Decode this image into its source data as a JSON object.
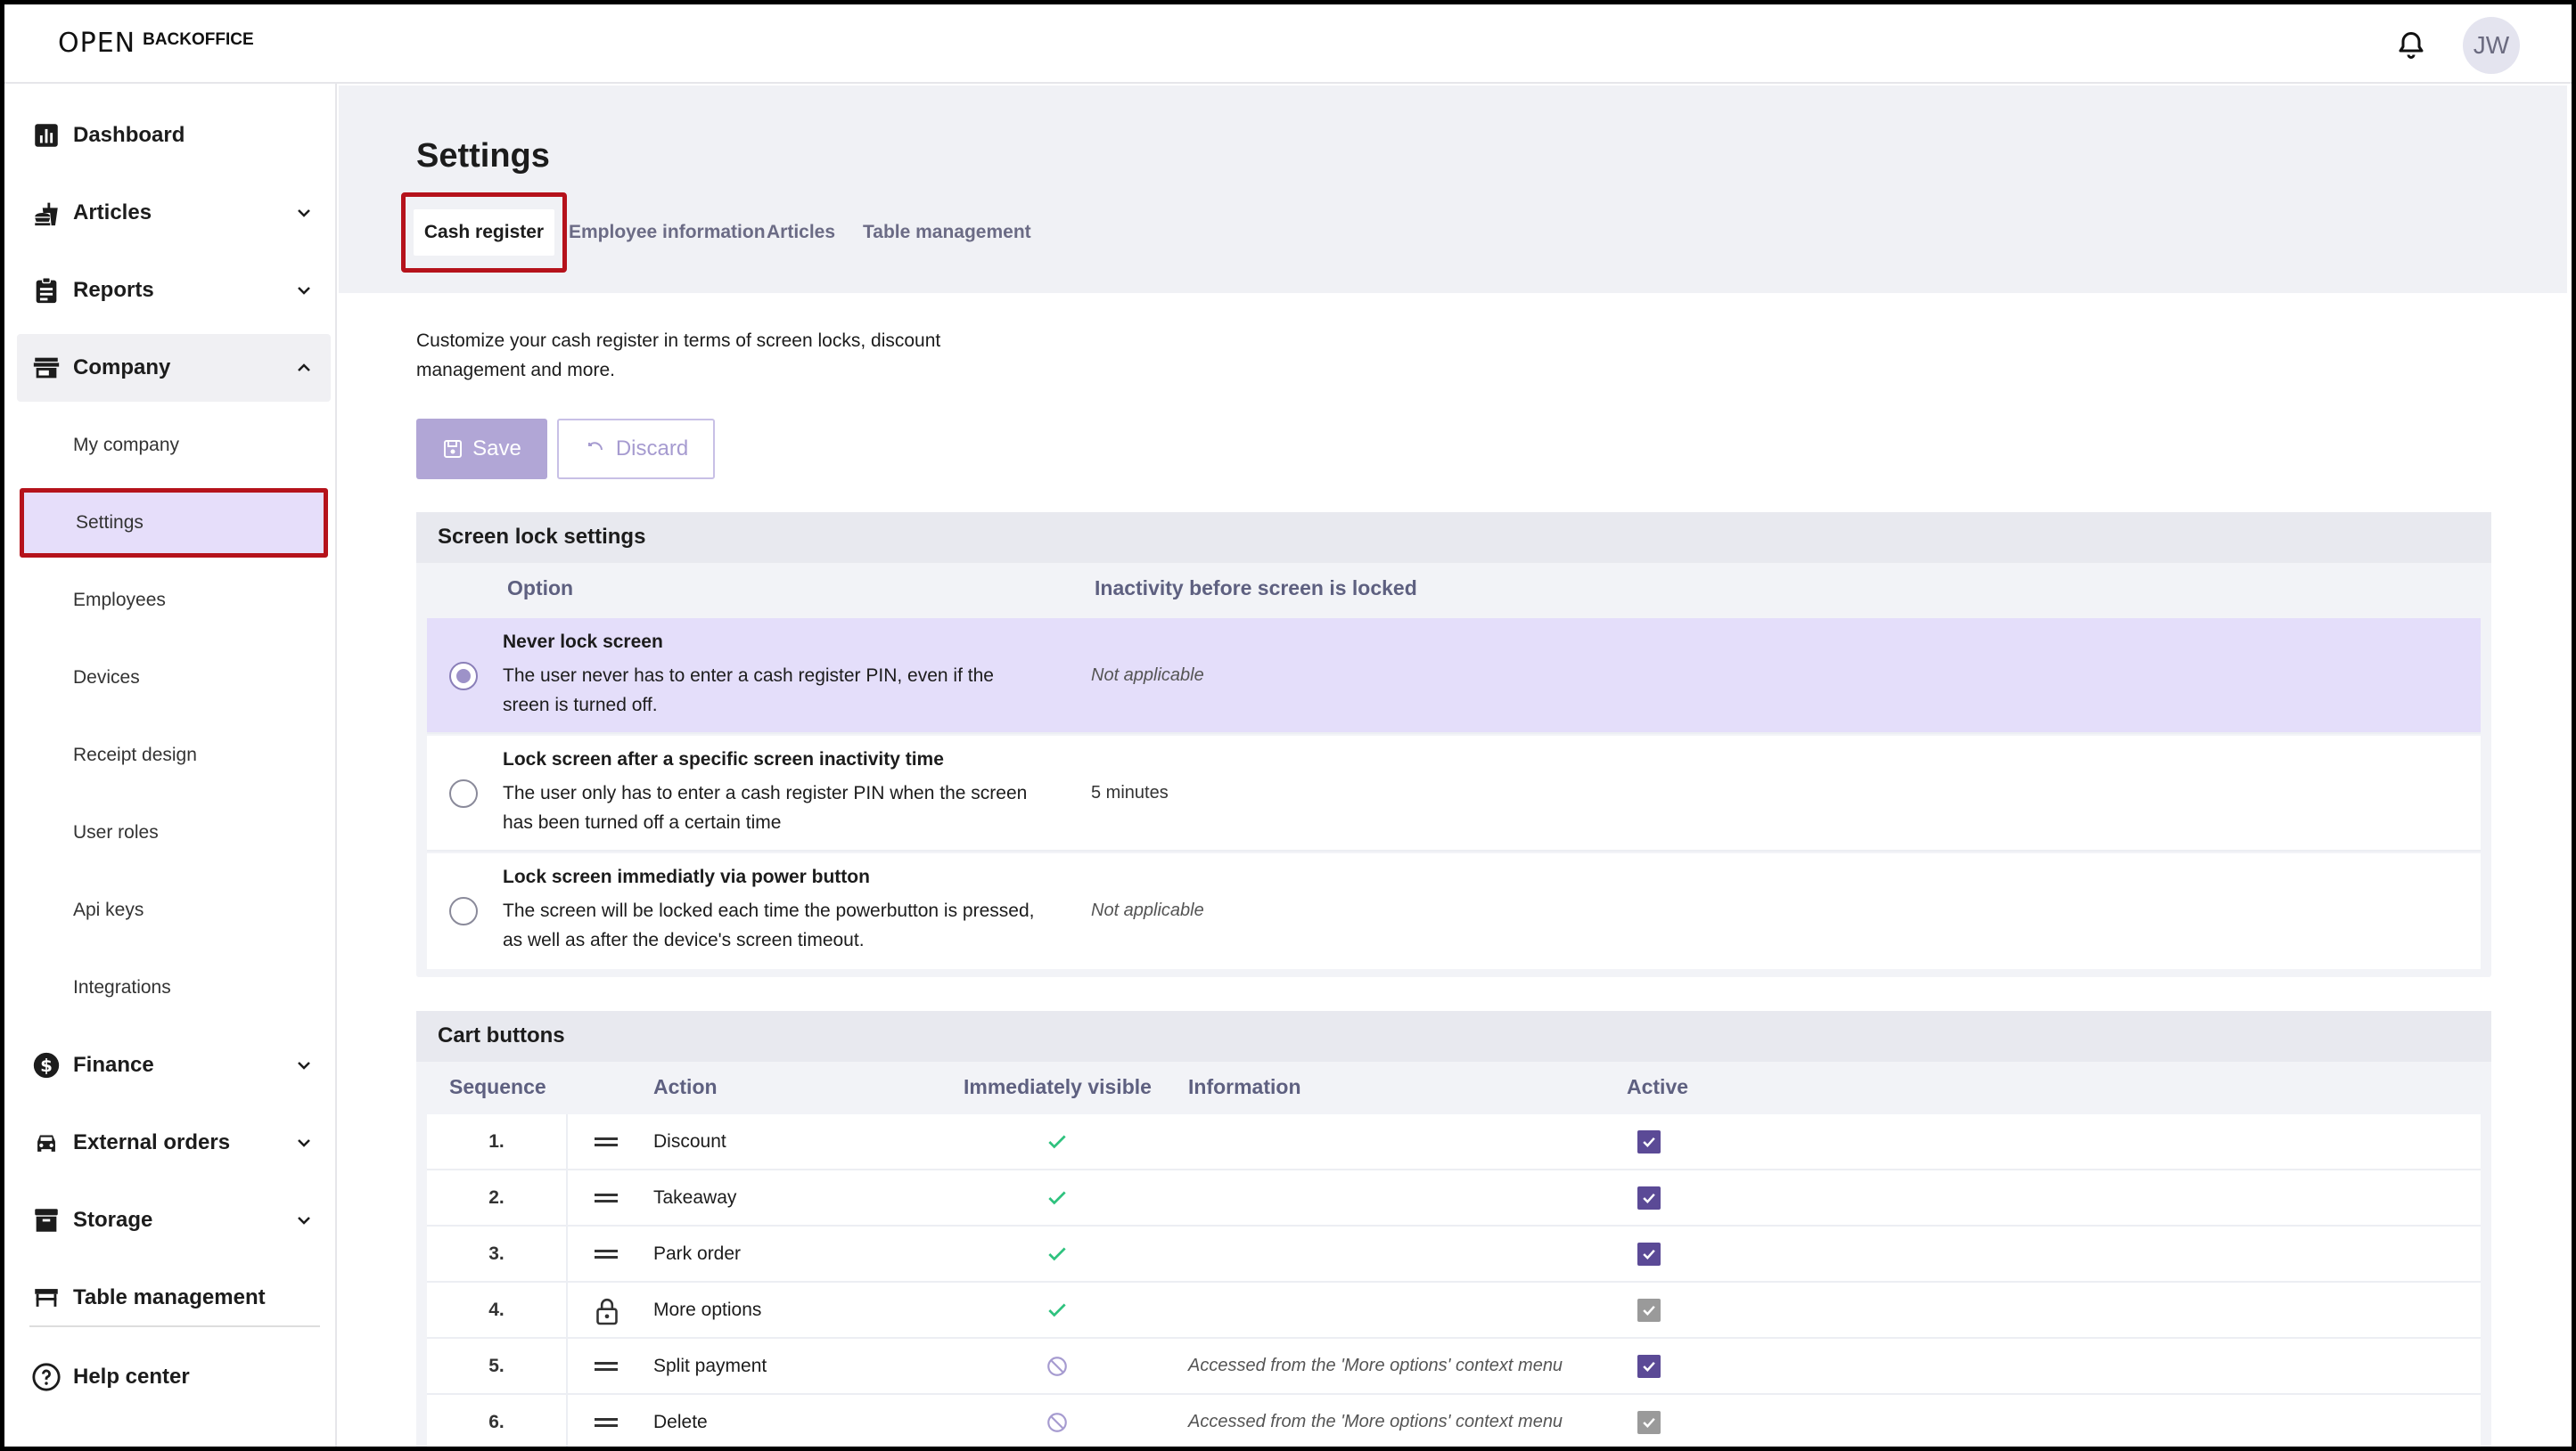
{
  "app": {
    "logo_text": "OPEN",
    "logo_sub": "BACKOFFICE",
    "avatar_initials": "JW"
  },
  "sidebar": {
    "items": [
      {
        "label": "Dashboard"
      },
      {
        "label": "Articles"
      },
      {
        "label": "Reports"
      },
      {
        "label": "Company"
      },
      {
        "label": "Finance"
      },
      {
        "label": "External orders"
      },
      {
        "label": "Storage"
      },
      {
        "label": "Table management"
      },
      {
        "label": "Help center"
      }
    ],
    "company_sub": [
      {
        "label": "My company"
      },
      {
        "label": "Settings"
      },
      {
        "label": "Employees"
      },
      {
        "label": "Devices"
      },
      {
        "label": "Receipt design"
      },
      {
        "label": "User roles"
      },
      {
        "label": "Api keys"
      },
      {
        "label": "Integrations"
      }
    ]
  },
  "page": {
    "title": "Settings",
    "tabs": [
      {
        "label": "Cash register"
      },
      {
        "label": "Employee information"
      },
      {
        "label": "Articles"
      },
      {
        "label": "Table management"
      }
    ],
    "description": "Customize your cash register in terms of screen locks, discount management and more.",
    "save_label": "Save",
    "discard_label": "Discard"
  },
  "screen_lock": {
    "title": "Screen lock settings",
    "col_option": "Option",
    "col_inactivity": "Inactivity before screen is locked",
    "options": [
      {
        "title": "Never lock screen",
        "desc": "The user never has to enter a cash register PIN, even if the sreen is turned off.",
        "value": "Not applicable",
        "selected": true
      },
      {
        "title": "Lock screen after a specific screen inactivity time",
        "desc": "The user only has to enter a cash register PIN when the screen has been turned off a certain time",
        "value": "5 minutes",
        "selected": false
      },
      {
        "title": "Lock screen immediatly via power button",
        "desc": "The screen will be locked each time the powerbutton is pressed, as well as after the device's screen timeout.",
        "value": "Not applicable",
        "selected": false
      }
    ]
  },
  "cart_buttons": {
    "title": "Cart buttons",
    "col_sequence": "Sequence",
    "col_action": "Action",
    "col_visible": "Immediately visible",
    "col_information": "Information",
    "col_active": "Active",
    "rows": [
      {
        "seq": "1.",
        "action": "Discount",
        "visible": true,
        "info": "",
        "active": true,
        "locked": false
      },
      {
        "seq": "2.",
        "action": "Takeaway",
        "visible": true,
        "info": "",
        "active": true,
        "locked": false
      },
      {
        "seq": "3.",
        "action": "Park order",
        "visible": true,
        "info": "",
        "active": true,
        "locked": false
      },
      {
        "seq": "4.",
        "action": "More options",
        "visible": true,
        "info": "",
        "active": true,
        "locked": true
      },
      {
        "seq": "5.",
        "action": "Split payment",
        "visible": false,
        "info": "Accessed from the 'More options' context menu",
        "active": true,
        "locked": false
      },
      {
        "seq": "6.",
        "action": "Delete",
        "visible": false,
        "info": "Accessed from the 'More options' context menu",
        "active": true,
        "locked": true
      }
    ]
  },
  "colors": {
    "accent": "#5b4a96",
    "selected_row": "#e4defa",
    "highlight_border": "#b5121b",
    "check_green": "#2ec27e"
  }
}
